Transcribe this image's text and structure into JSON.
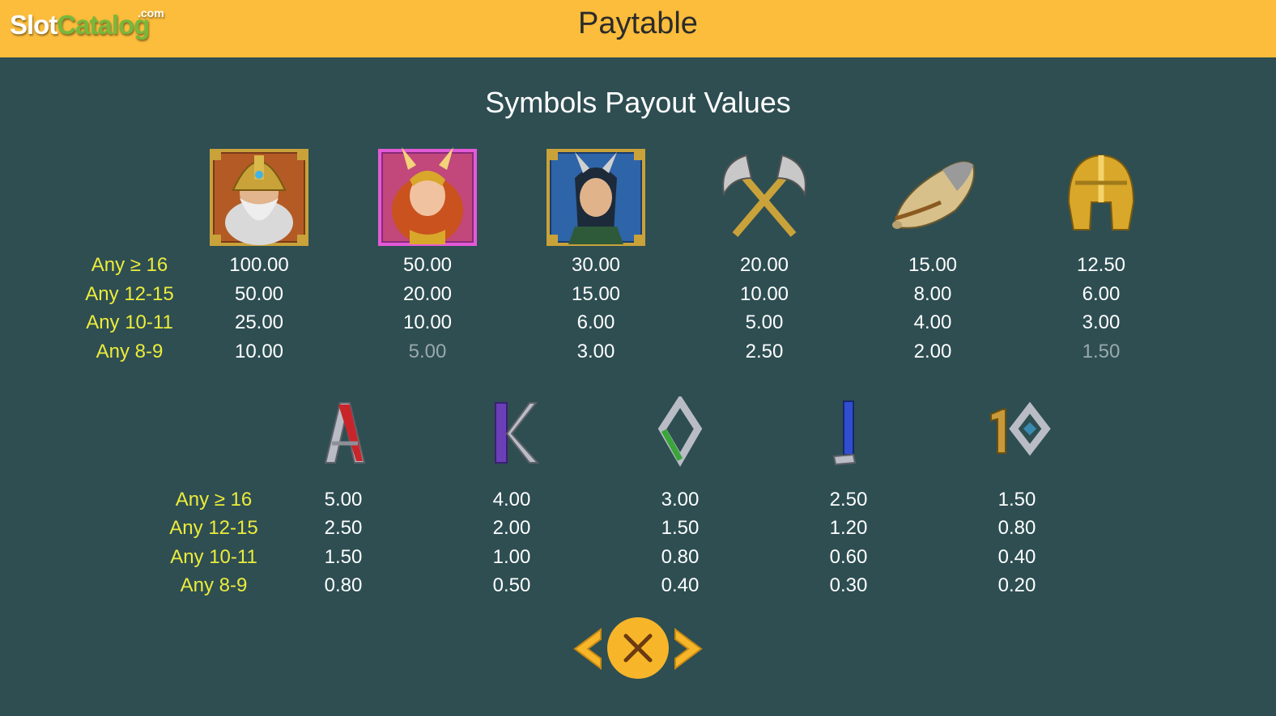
{
  "header": {
    "logo_part1": "Slot",
    "logo_part2": "Catalog",
    "logo_part3": ".com",
    "title": "Paytable"
  },
  "section_title": "Symbols Payout Values",
  "top_table": {
    "row_labels": [
      "Any ≥ 16",
      "Any 12-15",
      "Any 10-11",
      "Any 8-9"
    ],
    "symbols": [
      {
        "icon": "odin-icon",
        "values": [
          "100.00",
          "50.00",
          "25.00",
          "10.00"
        ]
      },
      {
        "icon": "freya-icon",
        "values": [
          "50.00",
          "20.00",
          "10.00",
          "5.00"
        ]
      },
      {
        "icon": "loki-icon",
        "values": [
          "30.00",
          "15.00",
          "6.00",
          "3.00"
        ]
      },
      {
        "icon": "crossed-axes-icon",
        "values": [
          "20.00",
          "10.00",
          "5.00",
          "2.50"
        ]
      },
      {
        "icon": "horn-icon",
        "values": [
          "15.00",
          "8.00",
          "4.00",
          "2.00"
        ]
      },
      {
        "icon": "helmet-icon",
        "values": [
          "12.50",
          "6.00",
          "3.00",
          "1.50"
        ]
      }
    ]
  },
  "bottom_table": {
    "row_labels": [
      "Any ≥ 16",
      "Any 12-15",
      "Any 10-11",
      "Any 8-9"
    ],
    "symbols": [
      {
        "icon": "rune-a-icon",
        "values": [
          "5.00",
          "2.50",
          "1.50",
          "0.80"
        ]
      },
      {
        "icon": "rune-k-icon",
        "values": [
          "4.00",
          "2.00",
          "1.00",
          "0.50"
        ]
      },
      {
        "icon": "rune-q-icon",
        "values": [
          "3.00",
          "1.50",
          "0.80",
          "0.40"
        ]
      },
      {
        "icon": "rune-j-icon",
        "values": [
          "2.50",
          "1.20",
          "0.60",
          "0.30"
        ]
      },
      {
        "icon": "rune-10-icon",
        "values": [
          "1.50",
          "0.80",
          "0.40",
          "0.20"
        ]
      }
    ]
  },
  "navigation": {
    "prev_icon": "chevron-left-icon",
    "close_icon": "close-icon",
    "next_icon": "chevron-right-icon"
  },
  "colors": {
    "background": "#2e4e52",
    "header": "#fbbd3b",
    "label": "#ecec3a",
    "value": "#ffffff",
    "accent": "#f7b52a"
  }
}
